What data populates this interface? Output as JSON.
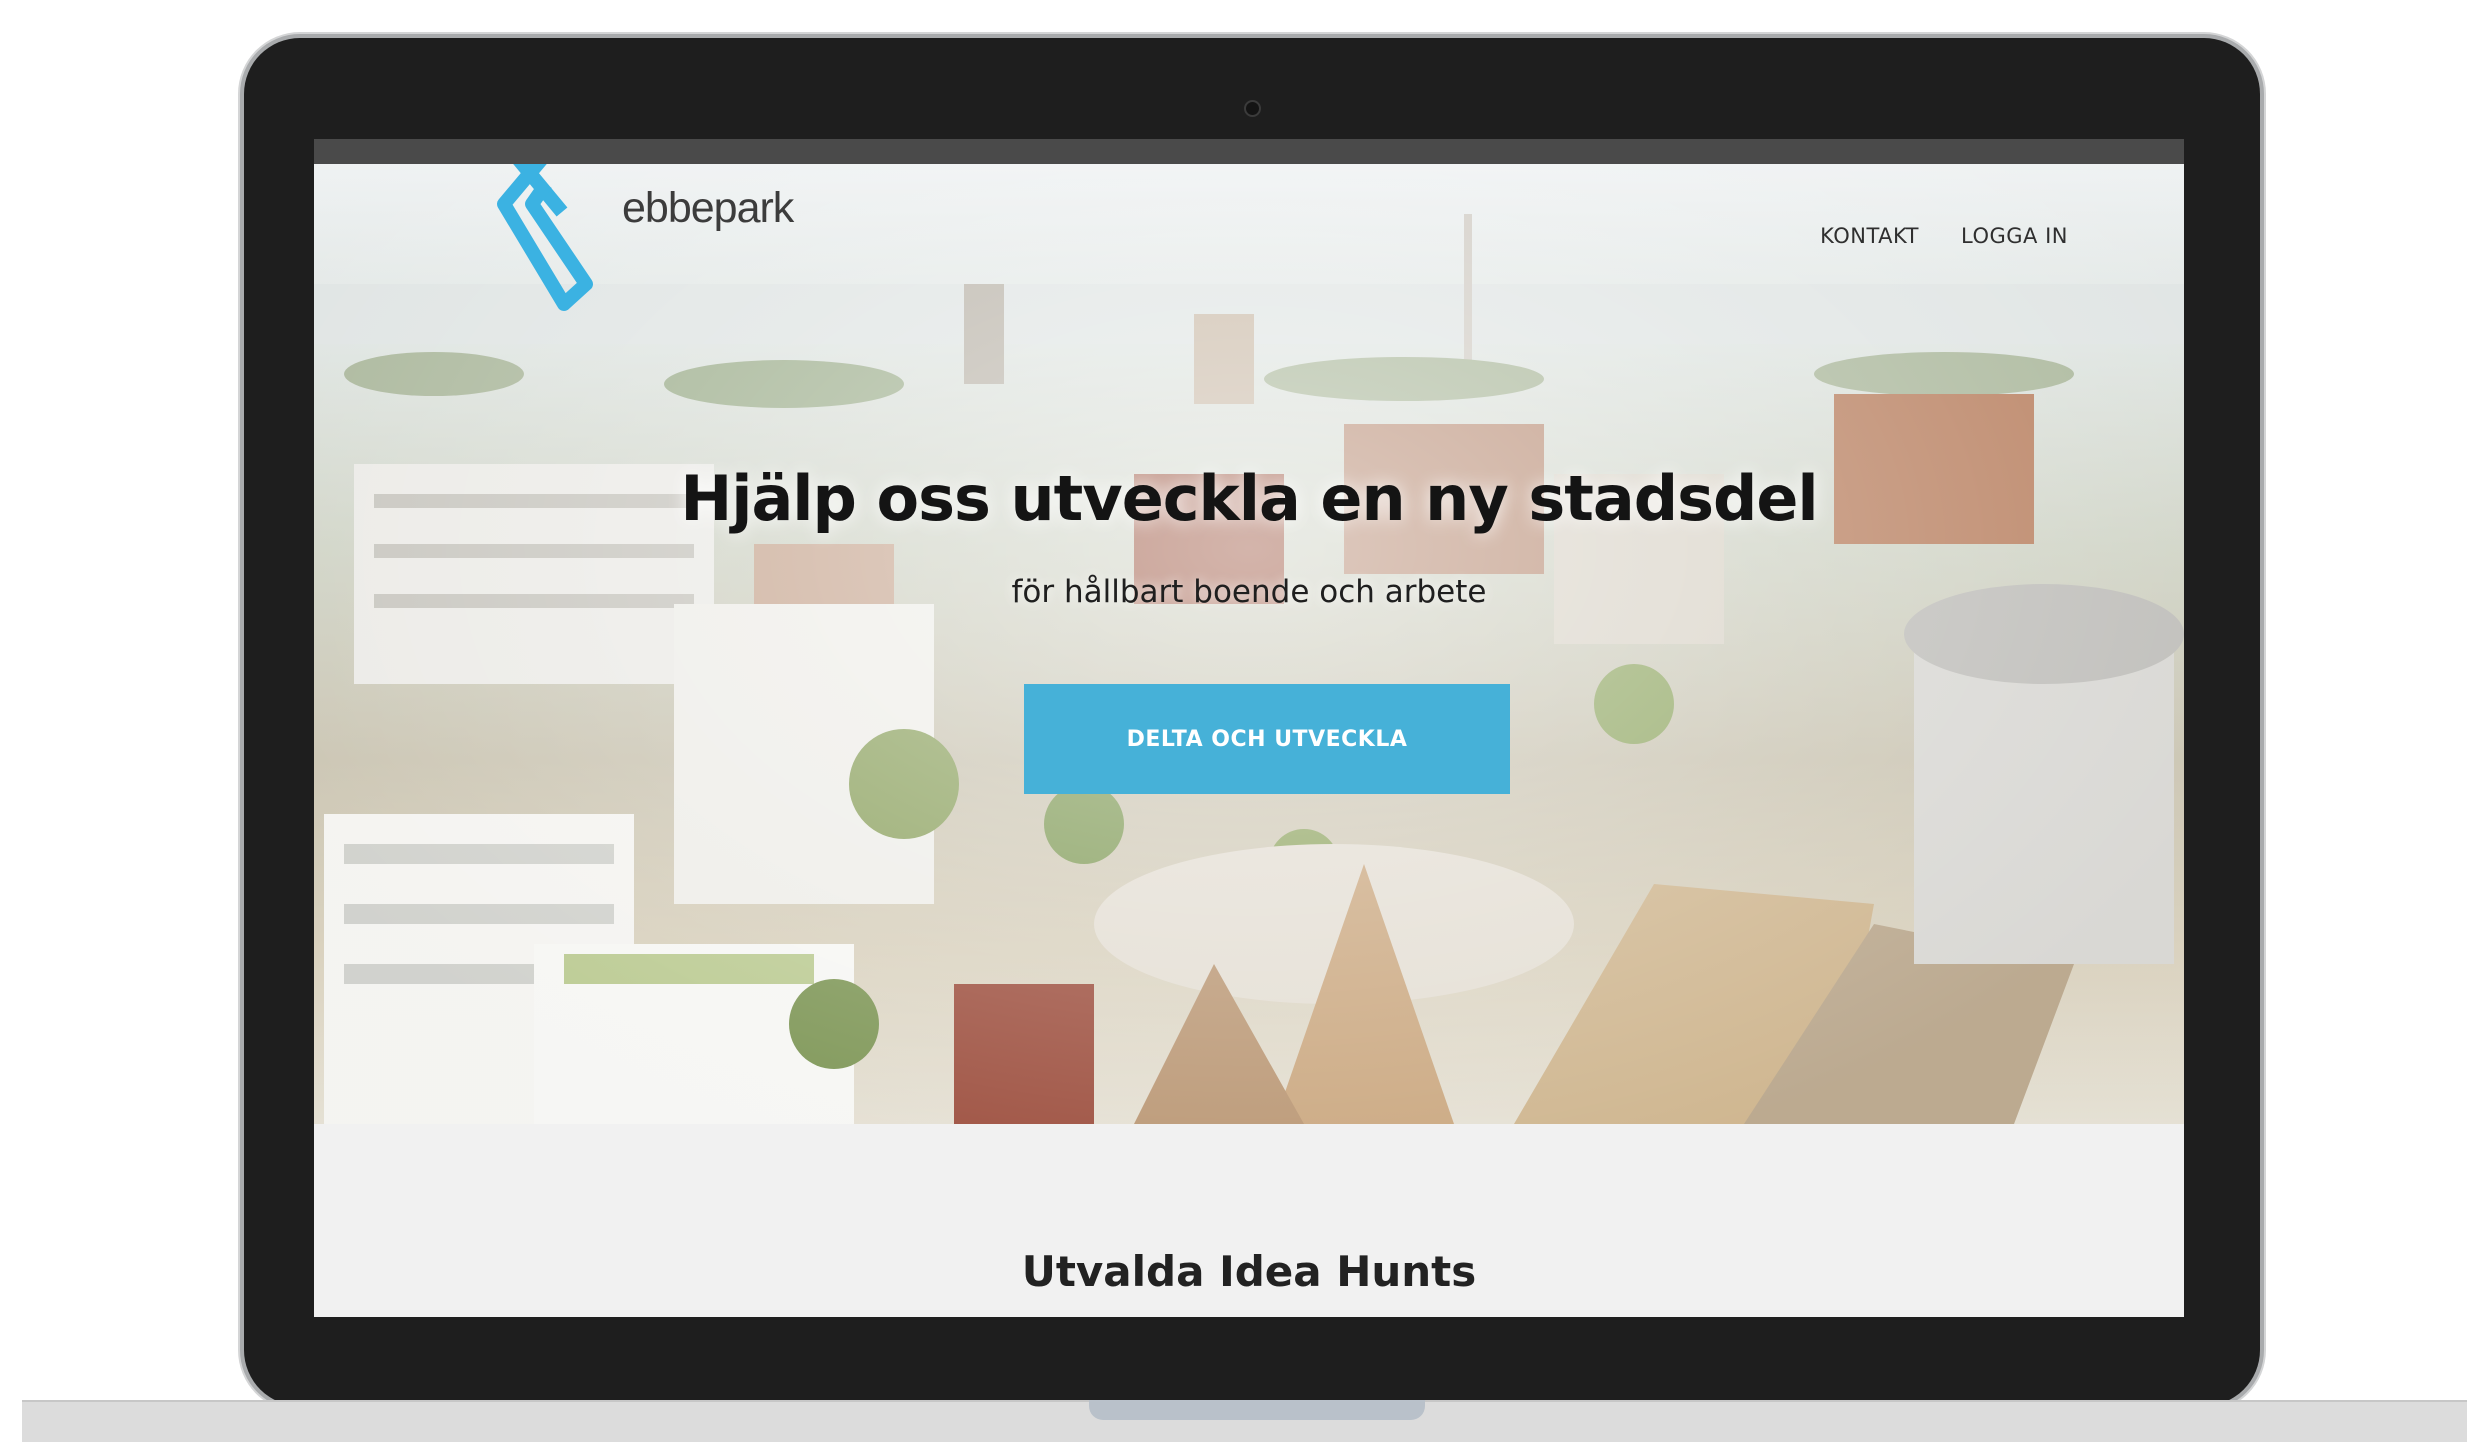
{
  "brand": {
    "name": "ebbepark",
    "accent": "#46b1d8"
  },
  "nav": {
    "contact": "KONTAKT",
    "login": "LOGGA IN"
  },
  "hero": {
    "headline": "Hjälp oss utveckla en ny stadsdel",
    "subline": "för hållbart boende och arbete",
    "cta": "DELTA OCH UTVECKLA"
  },
  "featured": {
    "title": "Utvalda Idea Hunts"
  },
  "icons": {
    "logo": "ebbepark-logo-mark",
    "camera": "webcam-icon"
  }
}
